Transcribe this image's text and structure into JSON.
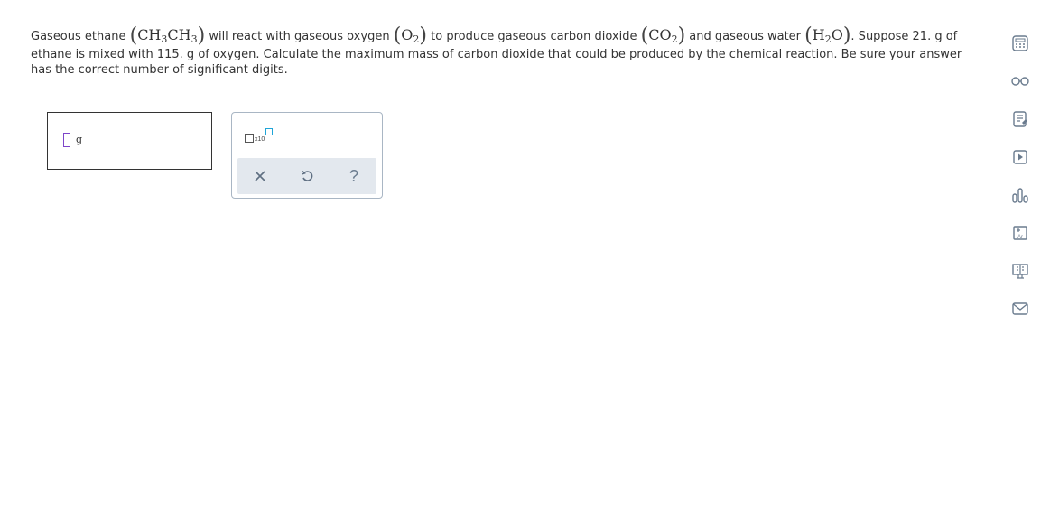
{
  "question": {
    "p1": "Gaseous ethane",
    "ethane_formula": [
      "CH",
      "3",
      "CH",
      "3"
    ],
    "p2": "will react with gaseous oxygen",
    "oxygen_formula": [
      "O",
      "2"
    ],
    "p3": "to produce gaseous carbon dioxide",
    "co2_formula": [
      "CO",
      "2"
    ],
    "p4": "and gaseous water",
    "water_formula": [
      "H",
      "2",
      "O"
    ],
    "p5": ". Suppose 21. g of",
    "line2": "ethane is mixed with 115. g of oxygen. Calculate the maximum mass of carbon dioxide that could be produced by the chemical reaction. Be sure your answer",
    "line3": "has the correct number of significant digits."
  },
  "answer": {
    "value": "",
    "unit": "g"
  },
  "tools": {
    "sci_notation_label": "x10",
    "clear": "×",
    "undo": "↺",
    "help": "?"
  },
  "sidebar_icons": [
    "calculator-icon",
    "glasses-icon",
    "notepad-icon",
    "video-icon",
    "chart-icon",
    "periodic-table-icon",
    "textbook-icon",
    "email-icon"
  ],
  "colors": {
    "input_cursor": "#7d45c9",
    "sci_exponent": "#1fa5d8",
    "tool_row_bg": "#e3e8ee",
    "icon_gray": "#6a7b8e"
  }
}
